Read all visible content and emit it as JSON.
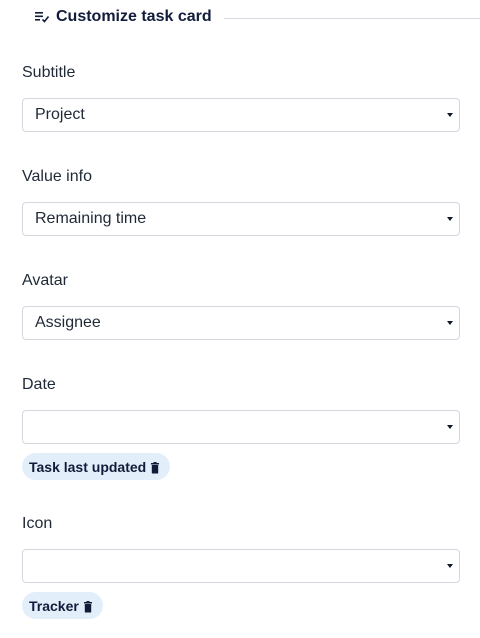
{
  "header": {
    "title": "Customize task card",
    "icon": "list-check-icon"
  },
  "fields": {
    "subtitle": {
      "label": "Subtitle",
      "value": "Project"
    },
    "value_info": {
      "label": "Value info",
      "value": "Remaining time"
    },
    "avatar": {
      "label": "Avatar",
      "value": "Assignee"
    },
    "date": {
      "label": "Date",
      "value": "",
      "chips": [
        "Task last updated"
      ]
    },
    "icon": {
      "label": "Icon",
      "value": "",
      "chips": [
        "Tracker"
      ]
    }
  },
  "colors": {
    "chip_bg": "#e3eefb",
    "title_text": "#111c3a",
    "border": "#d3d8df"
  }
}
